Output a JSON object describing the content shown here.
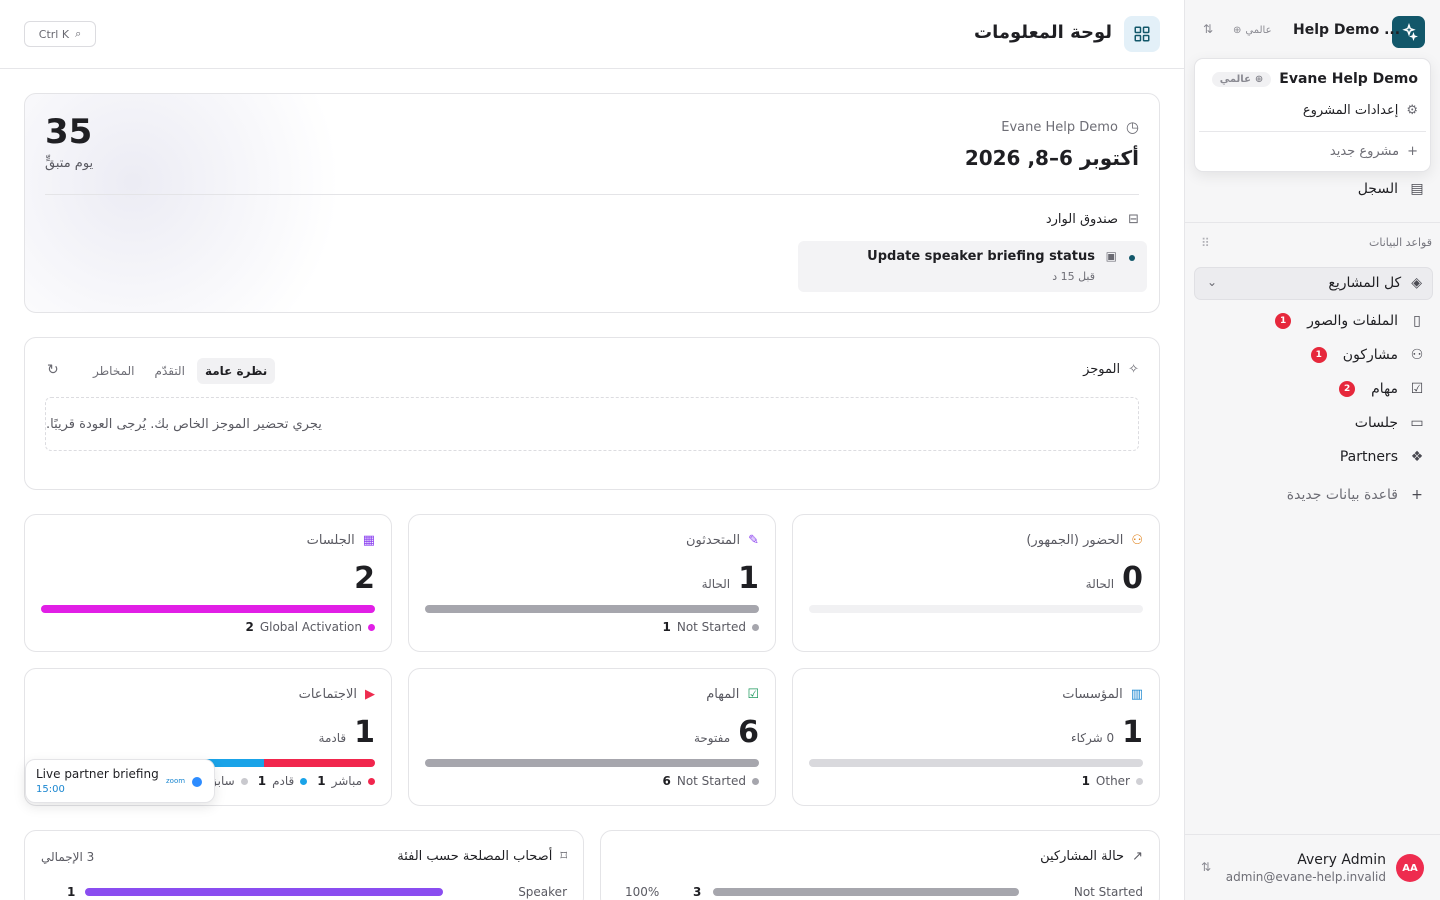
{
  "header": {
    "search_shortcut": "Ctrl K",
    "title": "لوحة المعلومات"
  },
  "sidebar": {
    "project_name": "Help Demo ...",
    "scope_tag": "عالمي",
    "dropdown": {
      "project_name": "Evane Help Demo",
      "scope_tag": "عالمي",
      "settings_label": "إعدادات المشروع",
      "new_project_label": "مشروع جديد"
    },
    "log_label": "السجل",
    "databases_heading": "قواعد البيانات",
    "all_projects_label": "كل المشاريع",
    "items": [
      {
        "label": "الملفات والصور",
        "badge": "1",
        "icon": "file-icon"
      },
      {
        "label": "مشاركون",
        "badge": "1",
        "icon": "users-icon"
      },
      {
        "label": "مهام",
        "badge": "2",
        "icon": "checklist-icon"
      },
      {
        "label": "جلسات",
        "badge": "",
        "icon": "presentation-icon"
      },
      {
        "label": "Partners",
        "badge": "",
        "icon": "partners-icon"
      }
    ],
    "new_database_label": "قاعدة بيانات جديدة",
    "user": {
      "initials": "AA",
      "name": "Avery Admin",
      "email": "admin@evane-help.invalid"
    }
  },
  "event": {
    "days_left": "35",
    "days_label": "يوم متبقٍّ",
    "org": "Evane Help Demo",
    "date_range": "أكتوبر 6–8, 2026",
    "inbox_label": "صندوق الوارد",
    "inbox_item": {
      "title": "Update speaker briefing status",
      "time": "قبل 15 د"
    }
  },
  "briefing": {
    "title": "الموجز",
    "tabs": [
      "نظرة عامة",
      "التقدّم",
      "المخاطر"
    ],
    "active_tab": 0,
    "empty_message": "يجري تحضير الموجز الخاص بك. يُرجى العودة قريبًا."
  },
  "stats": {
    "attendance": {
      "title": "الحضور (الجمهور)",
      "value": "0",
      "sub": "الحالة"
    },
    "speakers": {
      "title": "المتحدثون",
      "value": "1",
      "sub": "الحالة",
      "legend_label": "Not Started",
      "legend_count": "1",
      "fill": 1.0
    },
    "sessions": {
      "title": "الجلسات",
      "value": "2",
      "legend_label": "Global Activation",
      "legend_count": "2",
      "fill": 1.0
    },
    "organizations": {
      "title": "المؤسسات",
      "value": "1",
      "sub": "0 شركاء",
      "legend_label": "Other",
      "legend_count": "1",
      "fill": 1.0
    },
    "tasks": {
      "title": "المهام",
      "value": "6",
      "sub": "مفتوحة",
      "legend_label": "Not Started",
      "legend_count": "6",
      "fill": 1.0
    },
    "meetings": {
      "title": "الاجتماعات",
      "value": "1",
      "sub": "قادمة",
      "legend": [
        {
          "label": "مباشر",
          "count": "1",
          "color": "#f1264d"
        },
        {
          "label": "قادم",
          "count": "1",
          "color": "#1aa3e8"
        },
        {
          "label": "سابق",
          "count": "",
          "color": "#c9c9ce"
        }
      ]
    }
  },
  "toast": {
    "title": "Live partner briefing",
    "time": "15:00",
    "provider": "zoom"
  },
  "stakeholders": {
    "title": "أصحاب المصلحة حسب الفئة",
    "total_label": "3 الإجمالي",
    "row_label": "Speaker",
    "row_count": "1"
  },
  "participants_status": {
    "title": "حالة المشاركين",
    "row_label": "Not Started",
    "row_count": "3",
    "row_percent": "100%"
  },
  "colors": {
    "accent": "#12576a",
    "sessions_bar": "#e11fe6",
    "speakers_bar": "#a6a6ad",
    "tasks_bar": "#a6a6ad",
    "org_bar": "#d9d9dd",
    "meeting_live": "#f1264d",
    "meeting_upcoming": "#1aa3e8",
    "stakeholder_bar": "#8a4df0"
  }
}
